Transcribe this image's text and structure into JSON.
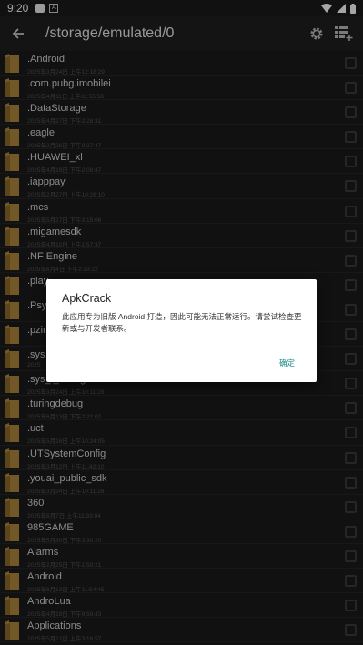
{
  "status_bar": {
    "time": "9:20",
    "notif_icon": "A"
  },
  "toolbar": {
    "path": "/storage/emulated/0"
  },
  "files": [
    {
      "name": ".Android",
      "date": "2025年3月24日 上午12:18:29"
    },
    {
      "name": ".com.pubg.imobilei",
      "date": "2025年4月11日 上午11:55:58"
    },
    {
      "name": ".DataStorage",
      "date": "2025年4月27日 下午2:28:31"
    },
    {
      "name": ".eagle",
      "date": "2025年2月26日 下午9:27:47"
    },
    {
      "name": ".HUAWEI_xl",
      "date": "2025年4月18日 下午2:08:47"
    },
    {
      "name": ".iapppay",
      "date": "2025年2月27日 上午10:28:10"
    },
    {
      "name": ".mcs",
      "date": "2025年5月27日 下午3:15:06"
    },
    {
      "name": ".migamesdk",
      "date": "2025年4月10日 上午1:57:37"
    },
    {
      "name": ".NF Engine",
      "date": "2025年6月4日 下午2:29:22"
    },
    {
      "name": ".play",
      "date": ""
    },
    {
      "name": ".Psy",
      "date": ""
    },
    {
      "name": ".pzir",
      "date": ""
    },
    {
      "name": ".sys",
      "date": "2025"
    },
    {
      "name": ".sys_ _config",
      "date": "2025年3月24日 上午10:11:28"
    },
    {
      "name": ".turingdebug",
      "date": "2025年6月13日 下午2:21:02"
    },
    {
      "name": ".uct",
      "date": "2025年5月16日 上午10:24:05"
    },
    {
      "name": ".UTSystemConfig",
      "date": "2025年3月12日 上午11:42:10"
    },
    {
      "name": ".youai_public_sdk",
      "date": "2025年3月24日 上午10:11:28"
    },
    {
      "name": "360",
      "date": "2025年6月7日 上午11:33:04"
    },
    {
      "name": "985GAME",
      "date": "2025年5月30日 下午3:30:20"
    },
    {
      "name": "Alarms",
      "date": "2025年2月25日 下午1:59:21"
    },
    {
      "name": "Android",
      "date": "2025年6月13日 上午11:54:45"
    },
    {
      "name": "AndroLua",
      "date": "2025年4月18日 下午9:59:43"
    },
    {
      "name": "Applications",
      "date": "2025年5月12日 上午3:16:57"
    }
  ],
  "dialog": {
    "title": "ApkCrack",
    "message": "此应用专为旧版 Android 打造，因此可能无法正常运行。请尝试检查更新或与开发者联系。",
    "ok_label": "确定"
  },
  "colors": {
    "folder": "#b0883c",
    "accent": "#1f8a8a",
    "background": "#1b1b1b"
  }
}
